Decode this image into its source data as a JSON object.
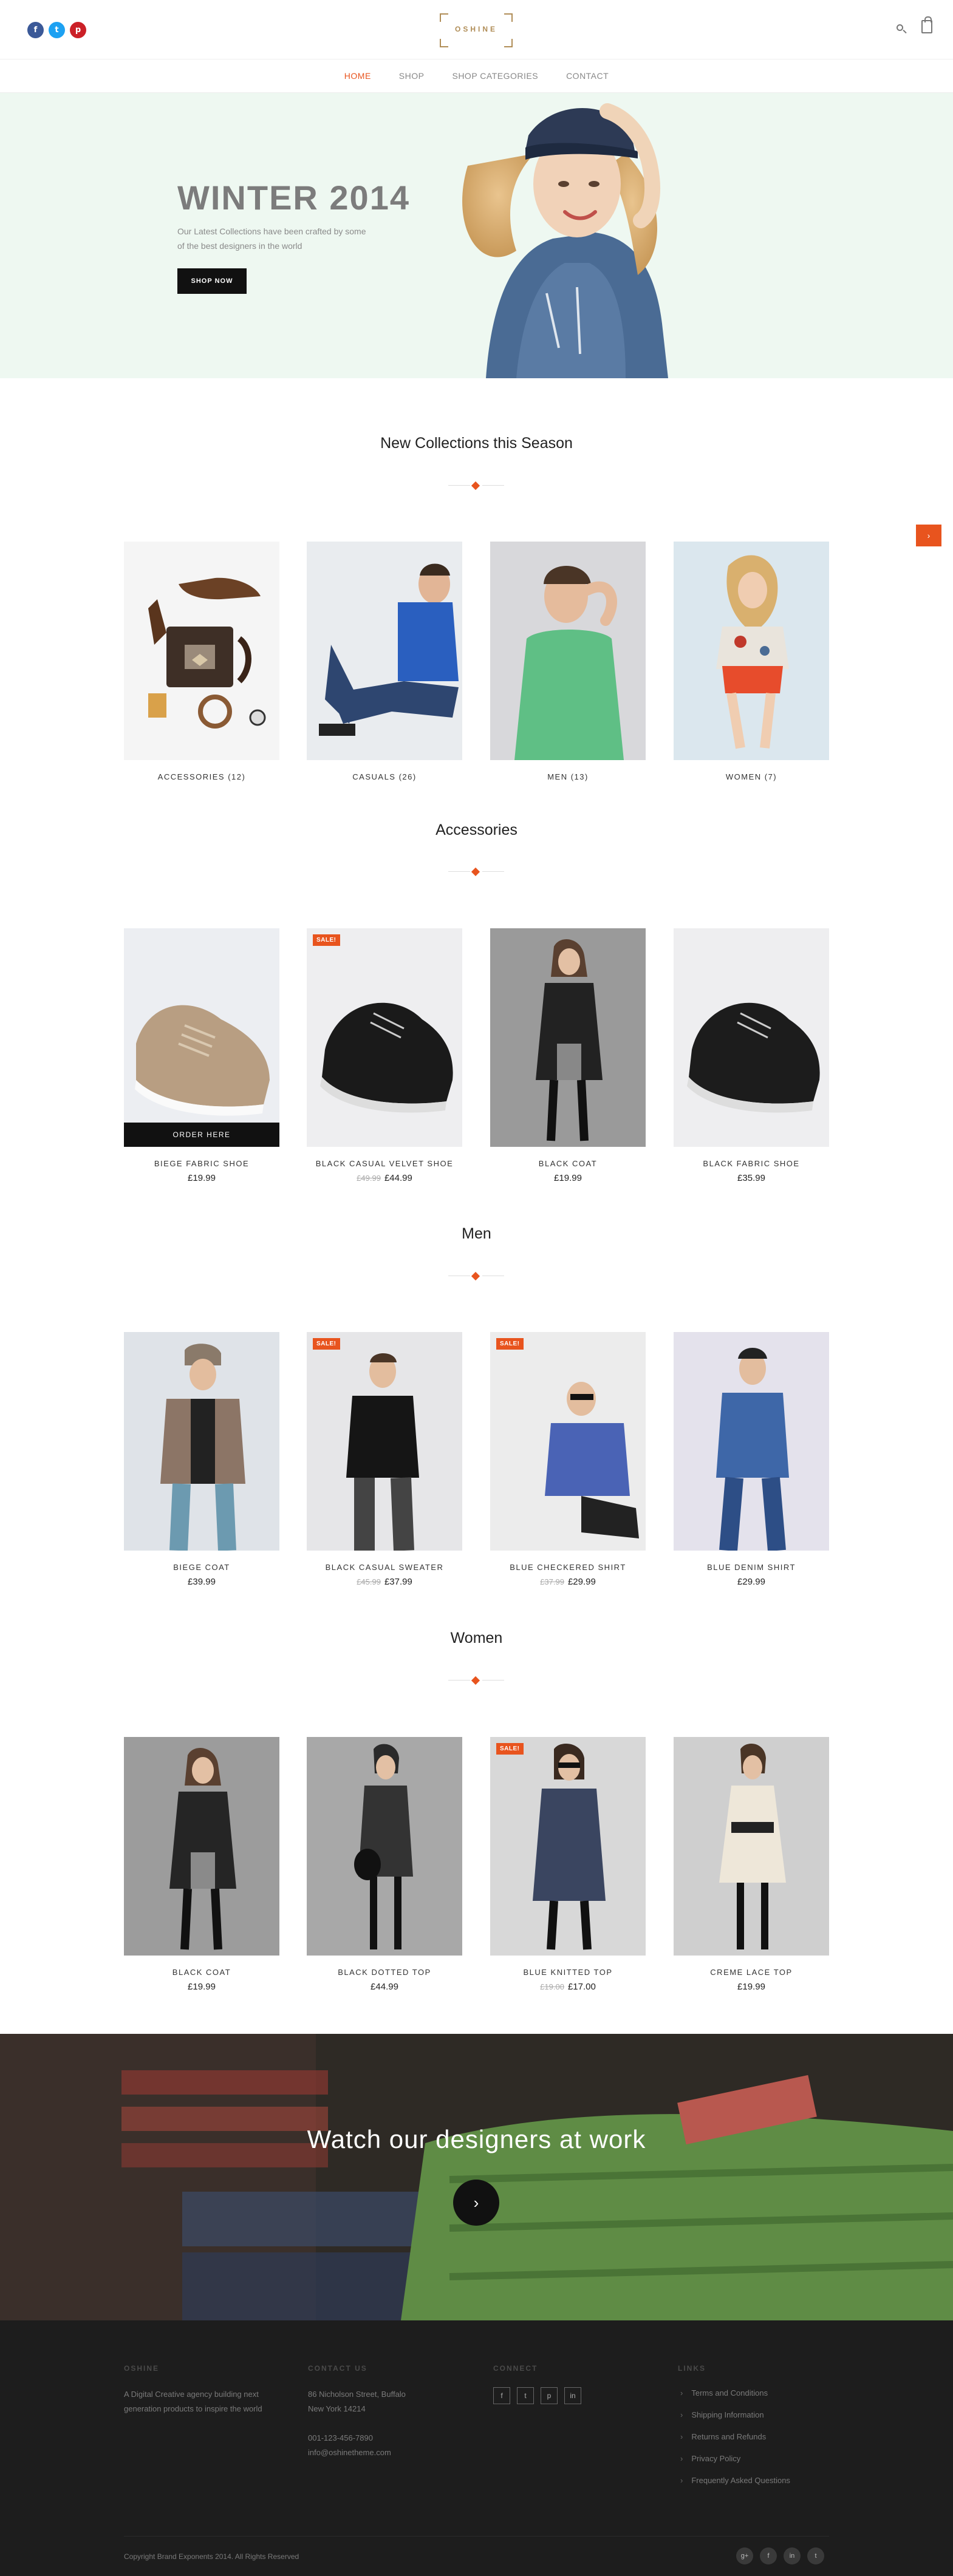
{
  "header": {
    "social": [
      {
        "icon": "facebook-icon",
        "glyph": "f",
        "color": "#3b5998"
      },
      {
        "icon": "twitter-icon",
        "glyph": "t",
        "color": "#1da1f2"
      },
      {
        "icon": "pinterest-icon",
        "glyph": "p",
        "color": "#cb2027"
      }
    ],
    "logo": "OSHINE",
    "search_icon": "search-icon",
    "cart_icon": "shopping-bag-icon"
  },
  "nav": [
    {
      "label": "HOME",
      "active": true
    },
    {
      "label": "SHOP",
      "active": false
    },
    {
      "label": "SHOP CATEGORIES",
      "active": false
    },
    {
      "label": "CONTACT",
      "active": false
    }
  ],
  "hero": {
    "title": "WINTER 2014",
    "subtitle": "Our Latest Collections have been crafted by some of the best designers in the world",
    "button": "SHOP NOW"
  },
  "float_button": {
    "glyph": "›",
    "icon": "chevron-icon"
  },
  "collections": {
    "title": "New Collections this Season",
    "items": [
      {
        "name": "ACCESSORIES (12)"
      },
      {
        "name": "CASUALS (26)"
      },
      {
        "name": "MEN (13)"
      },
      {
        "name": "WOMEN (7)"
      }
    ]
  },
  "accessories": {
    "title": "Accessories",
    "order_label": "ORDER HERE",
    "items": [
      {
        "name": "BIEGE FABRIC SHOE",
        "price": "£19.99",
        "old_price": "",
        "sale": ""
      },
      {
        "name": "BLACK CASUAL VELVET SHOE",
        "price": "£44.99",
        "old_price": "£49.99",
        "sale": "SALE!"
      },
      {
        "name": "BLACK COAT",
        "price": "£19.99",
        "old_price": "",
        "sale": ""
      },
      {
        "name": "BLACK FABRIC SHOE",
        "price": "£35.99",
        "old_price": "",
        "sale": ""
      }
    ]
  },
  "men": {
    "title": "Men",
    "items": [
      {
        "name": "BIEGE COAT",
        "price": "£39.99",
        "old_price": "",
        "sale": ""
      },
      {
        "name": "BLACK CASUAL SWEATER",
        "price": "£37.99",
        "old_price": "£45.99",
        "sale": "SALE!"
      },
      {
        "name": "BLUE CHECKERED SHIRT",
        "price": "£29.99",
        "old_price": "£37.99",
        "sale": "SALE!"
      },
      {
        "name": "BLUE DENIM SHIRT",
        "price": "£29.99",
        "old_price": "",
        "sale": ""
      }
    ]
  },
  "women": {
    "title": "Women",
    "items": [
      {
        "name": "BLACK COAT",
        "price": "£19.99",
        "old_price": "",
        "sale": ""
      },
      {
        "name": "BLACK DOTTED TOP",
        "price": "£44.99",
        "old_price": "",
        "sale": ""
      },
      {
        "name": "BLUE KNITTED TOP",
        "price": "£17.00",
        "old_price": "£19.00",
        "sale": "SALE!"
      },
      {
        "name": "CREME LACE TOP",
        "price": "£19.99",
        "old_price": "",
        "sale": ""
      }
    ]
  },
  "video": {
    "title": "Watch our designers at work",
    "play_icon": "play-icon",
    "play_glyph": "›"
  },
  "footer": {
    "col1": {
      "heading": "OSHINE",
      "text": "A Digital Creative agency building next generation products to inspire the world"
    },
    "col2": {
      "heading": "CONTACT US",
      "line1": "86 Nicholson Street, Buffalo",
      "line2": "New York 14214",
      "phone": "001-123-456-7890",
      "email": "info@oshinetheme.com"
    },
    "col3": {
      "heading": "CONNECT",
      "icons": [
        {
          "icon": "facebook-icon",
          "glyph": "f"
        },
        {
          "icon": "twitter-icon",
          "glyph": "t"
        },
        {
          "icon": "pinterest-icon",
          "glyph": "p"
        },
        {
          "icon": "linkedin-icon",
          "glyph": "in"
        }
      ]
    },
    "col4": {
      "heading": "LINKS",
      "links": [
        "Terms and Conditions",
        "Shipping Information",
        "Returns and Refunds",
        "Privacy Policy",
        "Frequently Asked Questions"
      ]
    },
    "copyright": "Copyright Brand Exponents 2014. All Rights Reserved",
    "bottom_icons": [
      {
        "icon": "google-plus-icon",
        "glyph": "g+"
      },
      {
        "icon": "facebook-icon",
        "glyph": "f"
      },
      {
        "icon": "linkedin-icon",
        "glyph": "in"
      },
      {
        "icon": "twitter-icon",
        "glyph": "t"
      }
    ]
  },
  "colors": {
    "accent": "#e8541e",
    "hero_bg": "#eef8f1",
    "footer_bg": "#1d1d1d",
    "logo": "#b08d57"
  }
}
